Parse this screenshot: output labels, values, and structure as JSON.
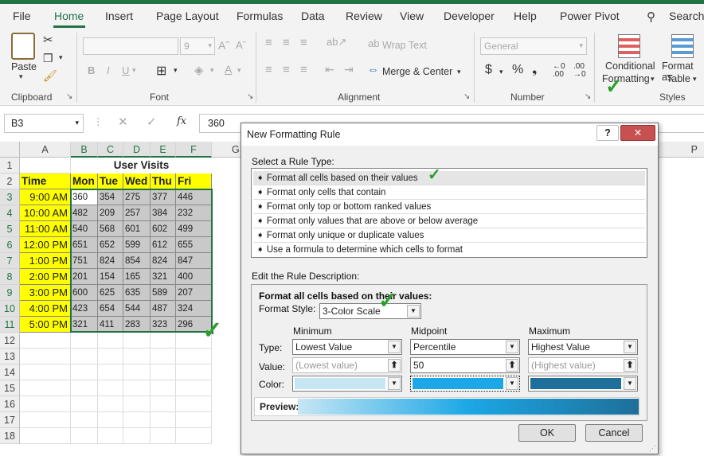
{
  "ribbon": {
    "tabs": [
      "File",
      "Home",
      "Insert",
      "Page Layout",
      "Formulas",
      "Data",
      "Review",
      "View",
      "Developer",
      "Help",
      "Power Pivot"
    ],
    "search_label": "Search",
    "paste_label": "Paste",
    "clipboard_label": "Clipboard",
    "font_label": "Font",
    "font_size": "9",
    "alignment_label": "Alignment",
    "wrap_text_label": "Wrap Text",
    "merge_center_label": "Merge & Center",
    "number_label": "Number",
    "number_format": "General",
    "styles_label": "Styles",
    "conditional_formatting_label1": "Conditional",
    "conditional_formatting_label2": "Formatting",
    "format_as_table_label1": "Format as",
    "format_as_table_label2": "Table"
  },
  "formula_bar": {
    "name_box": "B3",
    "content": "360",
    "fx": "fx"
  },
  "sheet": {
    "columns": [
      "A",
      "B",
      "C",
      "D",
      "E",
      "F",
      "G",
      "P"
    ],
    "rows": [
      "1",
      "2",
      "3",
      "4",
      "5",
      "6",
      "7",
      "8",
      "9",
      "10",
      "11",
      "12",
      "13",
      "14",
      "15",
      "16",
      "17",
      "18"
    ],
    "title": "User Visits",
    "headers": [
      "Time",
      "Mon",
      "Tue",
      "Wed",
      "Thu",
      "Fri"
    ],
    "data": [
      [
        "9:00 AM",
        "360",
        "354",
        "275",
        "377",
        "446"
      ],
      [
        "10:00 AM",
        "482",
        "209",
        "257",
        "384",
        "232"
      ],
      [
        "11:00 AM",
        "540",
        "568",
        "601",
        "602",
        "499"
      ],
      [
        "12:00 PM",
        "651",
        "652",
        "599",
        "612",
        "655"
      ],
      [
        "1:00 PM",
        "751",
        "824",
        "854",
        "824",
        "847"
      ],
      [
        "2:00 PM",
        "201",
        "154",
        "165",
        "321",
        "400"
      ],
      [
        "3:00 PM",
        "600",
        "625",
        "635",
        "589",
        "207"
      ],
      [
        "4:00 PM",
        "423",
        "654",
        "544",
        "487",
        "324"
      ],
      [
        "5:00 PM",
        "321",
        "411",
        "283",
        "323",
        "296"
      ]
    ]
  },
  "dialog": {
    "title": "New Formatting Rule",
    "help": "?",
    "close": "✕",
    "select_rule_type": "Select a Rule Type:",
    "rule_types": [
      "Format all cells based on their values",
      "Format only cells that contain",
      "Format only top or bottom ranked values",
      "Format only values that are above or below average",
      "Format only unique or duplicate values",
      "Use a formula to determine which cells to format"
    ],
    "edit_description": "Edit the Rule Description:",
    "format_all_label": "Format all cells based on their values:",
    "format_style_label": "Format Style:",
    "format_style_value": "3-Color Scale",
    "column_headers": [
      "Minimum",
      "Midpoint",
      "Maximum"
    ],
    "type_label": "Type:",
    "value_label": "Value:",
    "color_label": "Color:",
    "types": [
      "Lowest Value",
      "Percentile",
      "Highest Value"
    ],
    "values": [
      "(Lowest value)",
      "50",
      "(Highest value)"
    ],
    "colors": [
      "#c6e6f4",
      "#1ca7e6",
      "#1e6f99"
    ],
    "preview_label": "Preview:",
    "ok_label": "OK",
    "cancel_label": "Cancel"
  },
  "colors": {
    "excel_green": "#217346",
    "header_yellow": "#ffff00",
    "cell_gray": "#c9c9c9"
  }
}
